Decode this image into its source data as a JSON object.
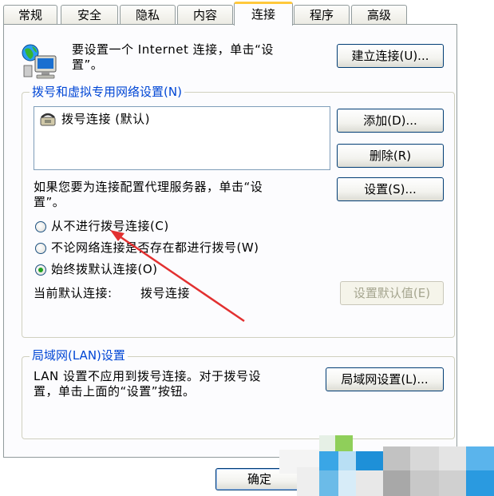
{
  "tabs": [
    "常规",
    "安全",
    "隐私",
    "内容",
    "连接",
    "程序",
    "高级"
  ],
  "active_tab": "连接",
  "setup": {
    "text_line1": "要设置一个 Internet 连接，单击“设",
    "text_line2": "置”。",
    "button": "建立连接(U)..."
  },
  "dialup": {
    "legend": "拨号和虚拟专用网络设置(N)",
    "list_items": [
      "拨号连接 (默认)"
    ],
    "add_button": "添加(D)...",
    "remove_button": "删除(R)",
    "settings_button": "设置(S)...",
    "proxy_text_line1": "如果您要为连接配置代理服务器，单击“设",
    "proxy_text_line2": "置”。",
    "radio_never": "从不进行拨号连接(C)",
    "radio_when_no_network": "不论网络连接是否存在都进行拨号(W)",
    "radio_always": "始终拨默认连接(O)",
    "selected_option": "始终拨默认连接(O)",
    "current_default_label": "当前默认连接:",
    "current_default_value": "拨号连接",
    "set_default_button": "设置默认值(E)"
  },
  "lan": {
    "legend": "局域网(LAN)设置",
    "text_line1": "LAN 设置不应用到拨号连接。对于拨号设",
    "text_line2": "置，单击上面的“设置”按钮。",
    "button": "局域网设置(L)..."
  },
  "footer": {
    "ok_button": "确定"
  },
  "colors": {
    "legend": "#0046d5",
    "active_tab_accent": "#ffc83c",
    "annotation_arrow": "#e23030",
    "selected_radio": "#21a121"
  }
}
